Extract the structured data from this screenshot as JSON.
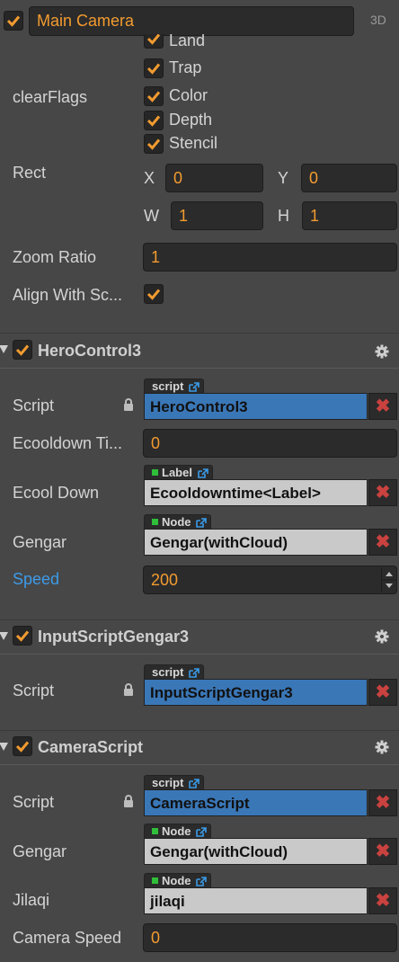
{
  "node": {
    "name": "Main Camera",
    "mode_label": "3D"
  },
  "camera": {
    "clear_flags_label": "clearFlags",
    "flags": [
      "Land",
      "Trap",
      "Color",
      "Depth",
      "Stencil"
    ],
    "rect_label": "Rect",
    "rect": {
      "x_label": "X",
      "x": "0",
      "y_label": "Y",
      "y": "0",
      "w_label": "W",
      "w": "1",
      "h_label": "H",
      "h": "1"
    },
    "zoom_label": "Zoom Ratio",
    "zoom": "1",
    "align_label": "Align With Sc..."
  },
  "hero": {
    "title": "HeroControl3",
    "script_label": "Script",
    "script_tag": "script",
    "script_value": "HeroControl3",
    "ecooldown_label": "Ecooldown Ti...",
    "ecooldown_value": "0",
    "ecool_down_label": "Ecool Down",
    "ecool_down_tag": "Label",
    "ecool_down_value": "Ecooldowntime<Label>",
    "gengar_label": "Gengar",
    "gengar_tag": "Node",
    "gengar_value": "Gengar(withCloud)",
    "speed_label": "Speed",
    "speed_value": "200"
  },
  "input": {
    "title": "InputScriptGengar3",
    "script_label": "Script",
    "script_tag": "script",
    "script_value": "InputScriptGengar3"
  },
  "camscript": {
    "title": "CameraScript",
    "script_label": "Script",
    "script_tag": "script",
    "script_value": "CameraScript",
    "gengar_label": "Gengar",
    "gengar_tag": "Node",
    "gengar_value": "Gengar(withCloud)",
    "jilaqi_label": "Jilaqi",
    "jilaqi_tag": "Node",
    "jilaqi_value": "jilaqi",
    "camspeed_label": "Camera Speed",
    "camspeed_value": "0"
  },
  "remove_symbol": "✖",
  "colors": {
    "accent_orange": "#f29b30",
    "script_blue": "#3a77b7",
    "remove_red": "#c9423f",
    "speed_blue": "#3d9be9"
  }
}
